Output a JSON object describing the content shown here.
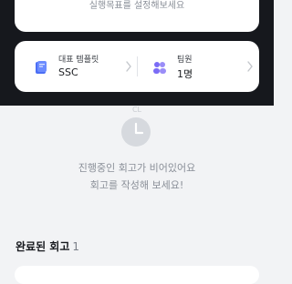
{
  "top_card": {
    "text": "실행목표를 설정해보세요"
  },
  "info_card": {
    "template": {
      "label": "대표 템플릿",
      "value": "SSC",
      "icon": "book-icon"
    },
    "team": {
      "label": "팀원",
      "value": "1명",
      "icon": "people-icon"
    }
  },
  "empty_state": {
    "badge": "CL",
    "line1": "진행중인 회고가 비어있어요",
    "line2": "회고를 작성해 보세요!",
    "icon": "clock-icon"
  },
  "completed_section": {
    "title": "완료된 회고",
    "count": "1"
  },
  "colors": {
    "accent": "#4b6ef5",
    "dark_header": "#16181d",
    "background": "#f2f3f5"
  }
}
